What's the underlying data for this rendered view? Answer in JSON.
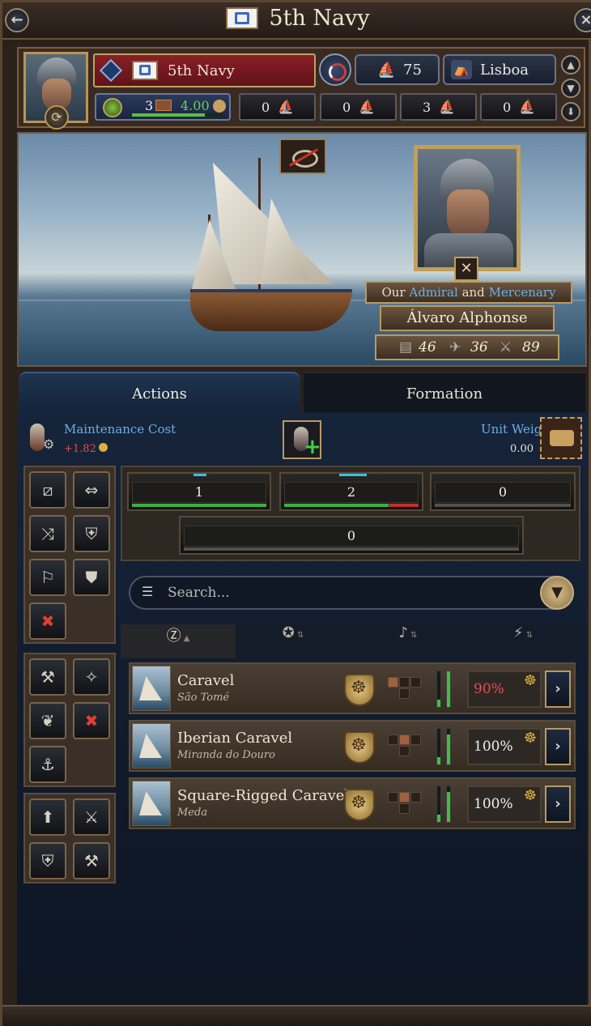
{
  "window": {
    "title": "5th Navy",
    "back_icon": "arrow-left-icon",
    "close_icon": "close-icon"
  },
  "army": {
    "name": "5th Navy",
    "ship_count": "75",
    "home_port": "Lisboa",
    "supply": {
      "count": "3",
      "rate": "4.00",
      "progress": 0.8
    },
    "ship_types": [
      "0",
      "0",
      "3",
      "0"
    ]
  },
  "commander": {
    "role_prefix": "Our",
    "role_a": "Admiral",
    "role_join": "and",
    "role_b": "Mercenary",
    "name": "Álvaro Alphonse",
    "stats": [
      "46",
      "36",
      "89"
    ]
  },
  "tabs": {
    "actions": "Actions",
    "formation": "Formation"
  },
  "maintenance": {
    "label": "Maintenance Cost",
    "value": "+1.82"
  },
  "unit_weight": {
    "label": "Unit Weight",
    "value": "0.00"
  },
  "formation_slots": [
    {
      "value": "1",
      "health": 1.0,
      "damage": 0
    },
    {
      "value": "2",
      "health": 0.78,
      "damage": 0.22
    },
    {
      "value": "0",
      "health": 0,
      "damage": 0
    },
    {
      "value": "0",
      "health": 0,
      "damage": 0
    }
  ],
  "search": {
    "placeholder": "Search..."
  },
  "sort_columns": [
    {
      "icon": "alphabet-sort-icon",
      "active": true
    },
    {
      "icon": "medal-sort-icon",
      "active": false
    },
    {
      "icon": "horn-sort-icon",
      "active": false
    },
    {
      "icon": "lightning-sort-icon",
      "active": false
    }
  ],
  "ships": [
    {
      "name": "Caravel",
      "port": "São Tomé",
      "morale": "90%",
      "low": true,
      "bar1": 0.2,
      "bar2": 1.0
    },
    {
      "name": "Iberian Caravel",
      "port": "Miranda do Douro",
      "morale": "100%",
      "low": false,
      "bar1": 0.2,
      "bar2": 0.85
    },
    {
      "name": "Square-Rigged Caravel",
      "port": "Meda",
      "morale": "100%",
      "low": false,
      "bar1": 0.2,
      "bar2": 0.85
    }
  ],
  "colors": {
    "accent_blue": "#6ab0e8",
    "health_green": "#3ab040",
    "damage_red": "#c03030",
    "frame_gold": "#b89a62"
  }
}
